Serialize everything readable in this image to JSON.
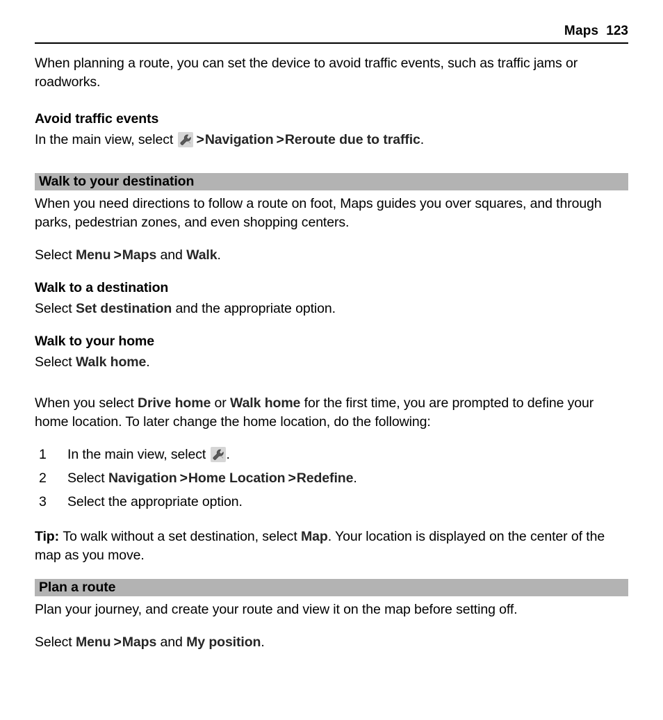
{
  "header": {
    "title": "Maps",
    "page_number": "123"
  },
  "icons": {
    "wrench": "wrench-icon"
  },
  "colors": {
    "section_bar": "#b3b3b3",
    "text": "#000000",
    "ui_term": "#262626",
    "icon_background": "#d6d6d6",
    "icon_glyph": "#5a5a5a"
  },
  "body": {
    "intro_paragraph": "When planning a route, you can set the device to avoid traffic events, such as traffic jams or roadworks.",
    "avoid_traffic": {
      "heading": "Avoid traffic events",
      "instruction_prefix": "In the main view, select",
      "arrow_1": ">",
      "term_1": "Navigation",
      "arrow_2": ">",
      "term_2": "Reroute due to traffic",
      "period": "."
    },
    "walk_section": {
      "bar_title": "Walk to your destination",
      "paragraph": "When you need directions to follow a route on foot, Maps guides you over squares, and through parks, pedestrian zones, and even shopping centers.",
      "select_prefix": "Select",
      "select_term_1": "Menu",
      "select_arrow": ">",
      "select_term_2": "Maps",
      "select_conjunction": "and",
      "select_term_3": "Walk",
      "select_period": ".",
      "sub_1": {
        "heading": "Walk to a destination",
        "prefix": "Select",
        "term": "Set destination",
        "suffix": "and the appropriate option."
      },
      "sub_2": {
        "heading": "Walk to your home",
        "prefix": "Select",
        "term": "Walk home",
        "suffix": "."
      },
      "home_paragraph_part_1": "When you select",
      "home_term_1": "Drive home",
      "home_paragraph_part_2": "or",
      "home_term_2": "Walk home",
      "home_paragraph_part_3": "for the first time, you are prompted to define your home location. To later change the home location, do the following:",
      "steps": [
        {
          "number": "1",
          "text_before_icon": "In the main view, select",
          "has_icon": true,
          "text_after_icon": "."
        },
        {
          "number": "2",
          "prefix": "Select",
          "term_1": "Navigation",
          "arrow_1": ">",
          "term_2": "Home Location",
          "arrow_2": ">",
          "term_3": "Redefine",
          "period": "."
        },
        {
          "number": "3",
          "text": "Select the appropriate option."
        }
      ],
      "tip": {
        "label": "Tip:",
        "text_before_term": "To walk without a set destination, select",
        "term": "Map",
        "text_after_term": ". Your location is displayed on the center of the map as you move."
      }
    },
    "plan_section": {
      "bar_title": "Plan a route",
      "paragraph": "Plan your journey, and create your route and view it on the map before setting off.",
      "select_prefix": "Select",
      "select_term_1": "Menu",
      "select_arrow": ">",
      "select_term_2": "Maps",
      "select_conjunction": "and",
      "select_term_3": "My position",
      "select_period": "."
    }
  }
}
